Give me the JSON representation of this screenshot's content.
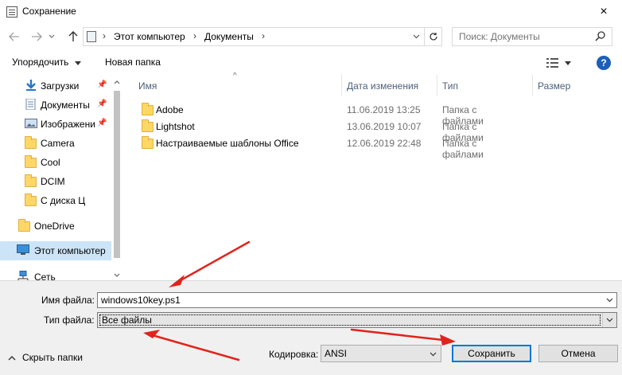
{
  "window": {
    "title": "Сохранение",
    "close_icon": "×"
  },
  "address": {
    "crumbs": [
      "Этот компьютер",
      "Документы"
    ],
    "search_placeholder": "Поиск: Документы"
  },
  "toolbar": {
    "organize_label": "Упорядочить",
    "new_folder_label": "Новая папка",
    "help_label": "?"
  },
  "nav": {
    "items": [
      {
        "label": "Загрузки",
        "icon": "download-icon",
        "pinned": true
      },
      {
        "label": "Документы",
        "icon": "document-icon",
        "pinned": true
      },
      {
        "label": "Изображени",
        "icon": "image-icon",
        "pinned": true
      },
      {
        "label": "Camera",
        "icon": "folder-icon",
        "pinned": false
      },
      {
        "label": "Cool",
        "icon": "folder-icon",
        "pinned": false
      },
      {
        "label": "DCIM",
        "icon": "folder-icon",
        "pinned": false
      },
      {
        "label": "С диска Ц",
        "icon": "folder-icon",
        "pinned": false
      },
      {
        "label": "OneDrive",
        "icon": "folder-icon",
        "pinned": false
      },
      {
        "label": "Этот компьютер",
        "icon": "computer-icon",
        "pinned": false,
        "selected": true
      },
      {
        "label": "Сеть",
        "icon": "network-icon",
        "pinned": false
      }
    ]
  },
  "filelist": {
    "columns": [
      "Имя",
      "Дата изменения",
      "Тип",
      "Размер"
    ],
    "rows": [
      {
        "name": "Adobe",
        "date": "11.06.2019 13:25",
        "type": "Папка с файлами"
      },
      {
        "name": "Lightshot",
        "date": "13.06.2019 10:07",
        "type": "Папка с файлами"
      },
      {
        "name": "Настраиваемые шаблоны Office",
        "date": "12.06.2019 22:48",
        "type": "Папка с файлами"
      }
    ]
  },
  "form": {
    "filename_label": "Имя файла:",
    "filename_value": "windows10key.ps1",
    "filetype_label": "Тип файла:",
    "filetype_value": "Все файлы",
    "hide_folders_label": "Скрыть папки",
    "encoding_label": "Кодировка:",
    "encoding_value": "ANSI",
    "save_label": "Сохранить",
    "cancel_label": "Отмена"
  },
  "colors": {
    "accent": "#0078d7",
    "selection": "#cce4f7",
    "annotation_arrow": "#e0241c",
    "folder": "#ffd766"
  }
}
